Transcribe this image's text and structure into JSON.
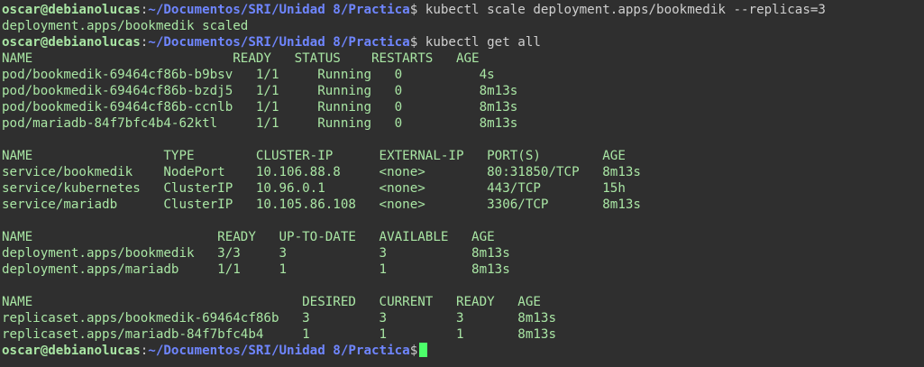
{
  "prompt": {
    "user_host": "oscar@debianolucas",
    "sep": ":",
    "path": "~/Documentos/SRI/Unidad 8/Practica",
    "symbol": "$"
  },
  "session": [
    {
      "type": "cmd",
      "cmd": " kubectl scale deployment.apps/bookmedik --replicas=3"
    },
    {
      "type": "out",
      "text": "deployment.apps/bookmedik scaled"
    },
    {
      "type": "cmd",
      "cmd": " kubectl get all"
    },
    {
      "type": "out",
      "text": "NAME                          READY   STATUS    RESTARTS   AGE"
    },
    {
      "type": "out",
      "text": "pod/bookmedik-69464cf86b-b9bsv   1/1     Running   0          4s"
    },
    {
      "type": "out",
      "text": "pod/bookmedik-69464cf86b-bzdj5   1/1     Running   0          8m13s"
    },
    {
      "type": "out",
      "text": "pod/bookmedik-69464cf86b-ccnlb   1/1     Running   0          8m13s"
    },
    {
      "type": "out",
      "text": "pod/mariadb-84f7bfc4b4-62ktl     1/1     Running   0          8m13s"
    },
    {
      "type": "out",
      "text": ""
    },
    {
      "type": "out",
      "text": "NAME                 TYPE        CLUSTER-IP      EXTERNAL-IP   PORT(S)        AGE"
    },
    {
      "type": "out",
      "text": "service/bookmedik    NodePort    10.106.88.8     <none>        80:31850/TCP   8m13s"
    },
    {
      "type": "out",
      "text": "service/kubernetes   ClusterIP   10.96.0.1       <none>        443/TCP        15h"
    },
    {
      "type": "out",
      "text": "service/mariadb      ClusterIP   10.105.86.108   <none>        3306/TCP       8m13s"
    },
    {
      "type": "out",
      "text": ""
    },
    {
      "type": "out",
      "text": "NAME                        READY   UP-TO-DATE   AVAILABLE   AGE"
    },
    {
      "type": "out",
      "text": "deployment.apps/bookmedik   3/3     3            3           8m13s"
    },
    {
      "type": "out",
      "text": "deployment.apps/mariadb     1/1     1            1           8m13s"
    },
    {
      "type": "out",
      "text": ""
    },
    {
      "type": "out",
      "text": "NAME                                   DESIRED   CURRENT   READY   AGE"
    },
    {
      "type": "out",
      "text": "replicaset.apps/bookmedik-69464cf86b   3         3         3       8m13s"
    },
    {
      "type": "out",
      "text": "replicaset.apps/mariadb-84f7bfc4b4     1         1         1       8m13s"
    },
    {
      "type": "prompt_only",
      "cmd": " "
    }
  ],
  "colors": {
    "background": "#2f2f2f",
    "user_host": "#a9e6a4",
    "path": "#6f86ff",
    "output": "#a9e6a4",
    "command": "#cfcfcf",
    "cursor": "#4cff6a"
  }
}
